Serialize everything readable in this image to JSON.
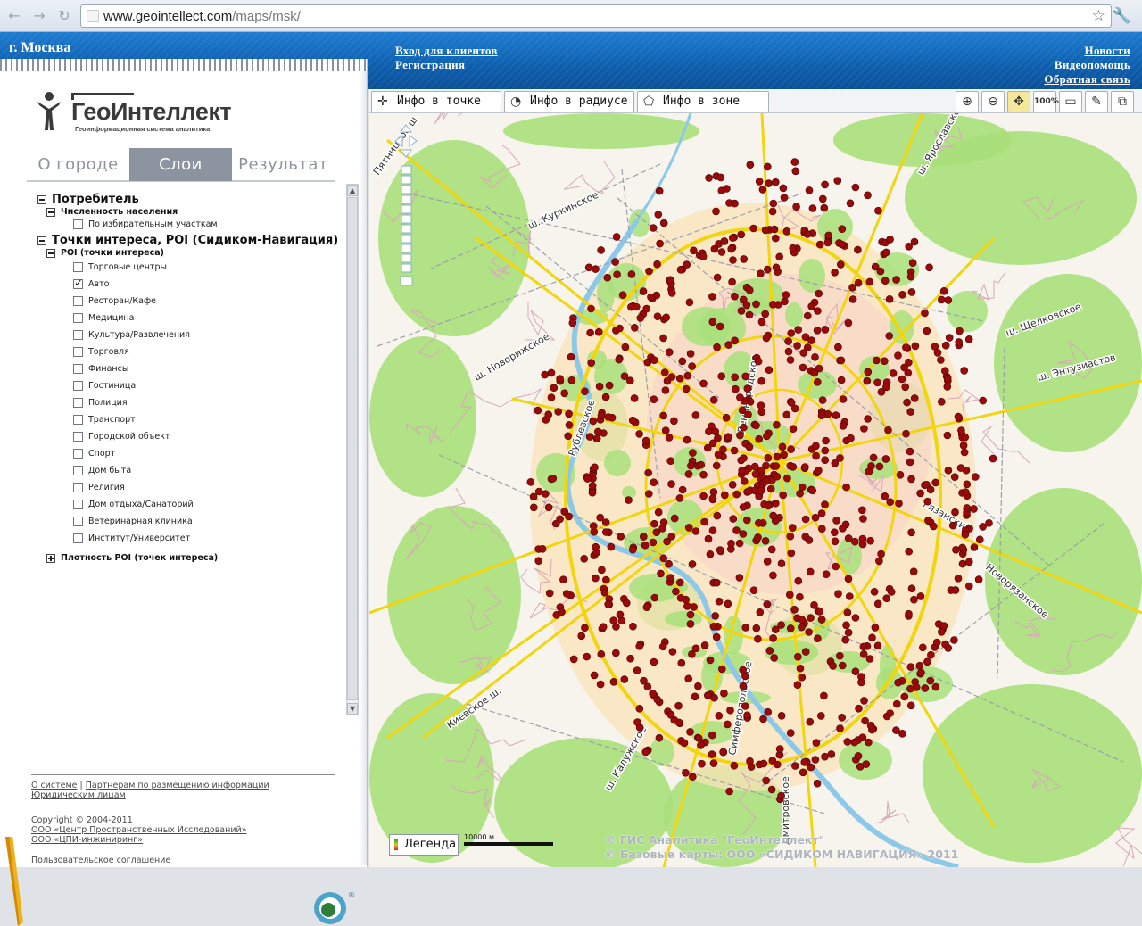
{
  "browser": {
    "url_host": "www.geointellect.com",
    "url_path": "/maps/msk/"
  },
  "header": {
    "city": "г. Москва",
    "left_links": [
      "Вход для клиентов",
      "Регистрация"
    ],
    "right_links": [
      "Новости",
      "Видеопомощь",
      "Обратная связь"
    ]
  },
  "logo": {
    "brand": "ГеоИнтеллект",
    "slogan": "Геоинформационная система аналитика"
  },
  "tabs": [
    "О городе",
    "Слои",
    "Результат"
  ],
  "active_tab": "Слои",
  "layers": {
    "group1": "Потребитель",
    "group1_sub": "Численность населения",
    "group1_item": "По избирательным участкам",
    "group2": "Точки интереса, POI (Сидиком-Навигация)",
    "group2_sub": "POI (точки интереса)",
    "poi_items": [
      {
        "label": "Торговые центры",
        "checked": false
      },
      {
        "label": "Авто",
        "checked": true
      },
      {
        "label": "Ресторан/Кафе",
        "checked": false
      },
      {
        "label": "Медицина",
        "checked": false
      },
      {
        "label": "Культура/Развлечения",
        "checked": false
      },
      {
        "label": "Торговля",
        "checked": false
      },
      {
        "label": "Финансы",
        "checked": false
      },
      {
        "label": "Гостиница",
        "checked": false
      },
      {
        "label": "Полиция",
        "checked": false
      },
      {
        "label": "Транспорт",
        "checked": false
      },
      {
        "label": "Городской объект",
        "checked": false
      },
      {
        "label": "Спорт",
        "checked": false
      },
      {
        "label": "Дом быта",
        "checked": false
      },
      {
        "label": "Религия",
        "checked": false
      },
      {
        "label": "Дом отдыха/Санаторий",
        "checked": false
      },
      {
        "label": "Ветеринарная клиника",
        "checked": false
      },
      {
        "label": "Институт/Университет",
        "checked": false
      }
    ],
    "density": "Плотность POI (точек интереса)"
  },
  "footer": {
    "link_about": "О системе",
    "divider": "|",
    "link_partners": "Партнерам по размещению информации",
    "link_legal": "Юридическим лицам",
    "copyright": "Copyright © 2004-2011",
    "org1": "ООО «Центр Пространственных Исследований»",
    "org2": "ООО «ЦПИ-инжиниринг»",
    "agreement": "Пользовательское соглашение"
  },
  "tools": {
    "info_point": "Инфо в точке",
    "info_radius": "Инфо в радиусе",
    "info_zone": "Инфо в зоне",
    "zoom100": "100%"
  },
  "map": {
    "legend": "Легенда",
    "scale": "10000 м",
    "copyright1": "© ГИС Аналитика \"ГеоИнтеллект\"",
    "copyright2": "© Базовые карты: ООО «СИДИКОМ НАВИГАЦИЯ» 2011",
    "road_labels": [
      "Пятницкое ш.",
      "ш. Куркинское",
      "ш. Новорижское",
      "Рублевское",
      "Киевское ш.",
      "ш. Калужское",
      "ш. Ярославское",
      "ш. Щелковское",
      "ш. Энтузиастов",
      "Рязанский",
      "Новорязанское",
      "Симферопольское",
      "Дмитровское",
      "Ленинградское"
    ],
    "poi_color": "#9b0a0a",
    "park_color": "#a8e07a",
    "urban_color": "#fbe3b8",
    "road_color": "#f1d60e"
  }
}
